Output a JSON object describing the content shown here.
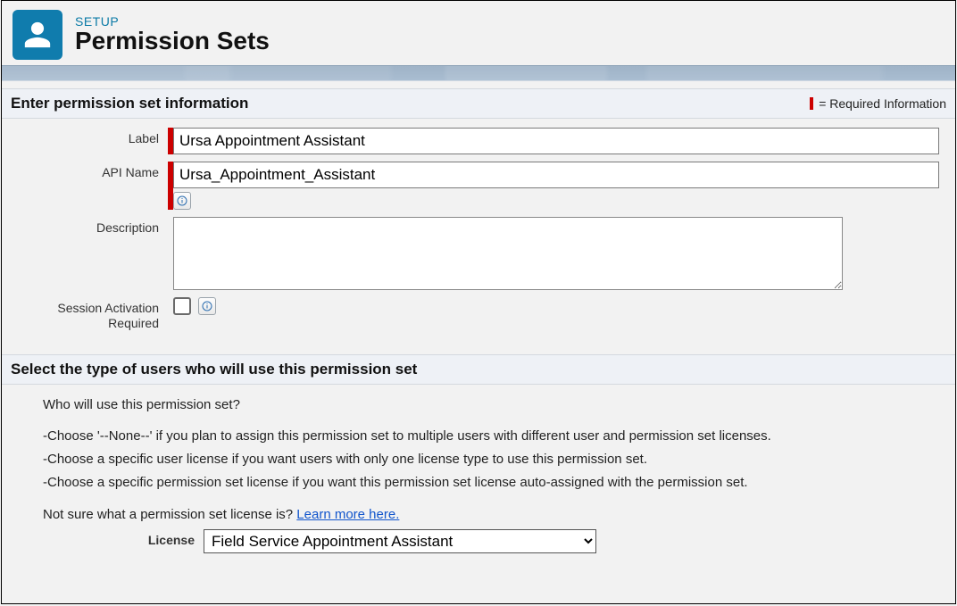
{
  "header": {
    "eyebrow": "SETUP",
    "title": "Permission Sets"
  },
  "section1": {
    "heading": "Enter permission set information",
    "required_text": "= Required Information",
    "labels": {
      "label": "Label",
      "api_name": "API Name",
      "description": "Description",
      "session": "Session Activation Required"
    },
    "values": {
      "label": "Ursa Appointment Assistant",
      "api_name": "Ursa_Appointment_Assistant",
      "description": "",
      "session_checked": false
    }
  },
  "section2": {
    "heading": "Select the type of users who will use this permission set",
    "intro": "Who will use this permission set?",
    "bullets": [
      "-Choose '--None--' if you plan to assign this permission set to multiple users with different user and permission set licenses.",
      "-Choose a specific user license if you want users with only one license type to use this permission set.",
      "-Choose a specific permission set license if you want this permission set license auto-assigned with the permission set."
    ],
    "learn_prefix": "Not sure what a permission set license is? ",
    "learn_link": "Learn more here.",
    "license_label": "License",
    "license_value": "Field Service Appointment Assistant"
  }
}
